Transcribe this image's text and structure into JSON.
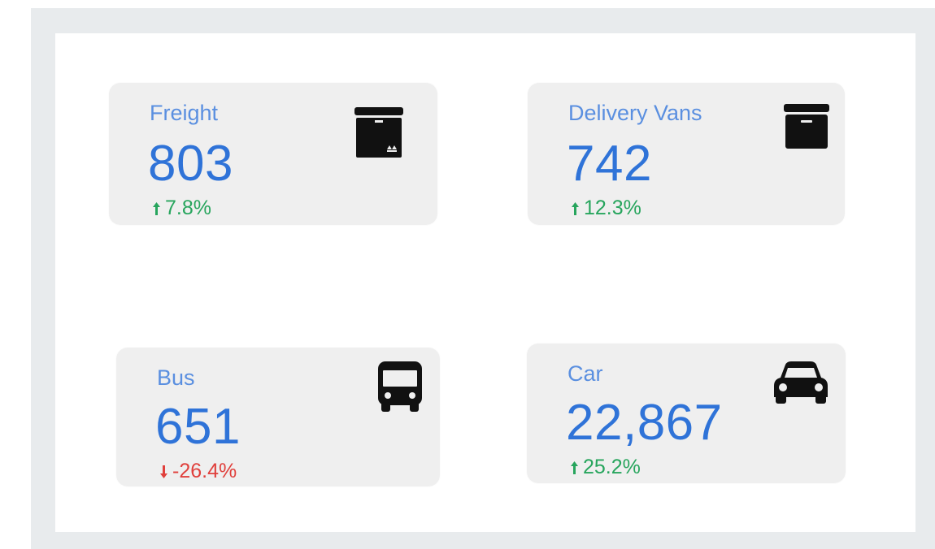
{
  "colors": {
    "label": "#5a8fe0",
    "value": "#2f73d8",
    "up": "#27a55d",
    "down": "#e0403c",
    "icon": "#111111"
  },
  "cards": [
    {
      "label": "Freight",
      "value": "803",
      "delta": "7.8%",
      "trend": "up",
      "icon": "package-box-icon"
    },
    {
      "label": "Delivery Vans",
      "value": "742",
      "delta": "12.3%",
      "trend": "up",
      "icon": "archive-box-icon"
    },
    {
      "label": "Bus",
      "value": "651",
      "delta": "-26.4%",
      "trend": "down",
      "icon": "bus-icon"
    },
    {
      "label": "Car",
      "value": "22,867",
      "delta": "25.2%",
      "trend": "up",
      "icon": "car-icon"
    }
  ]
}
